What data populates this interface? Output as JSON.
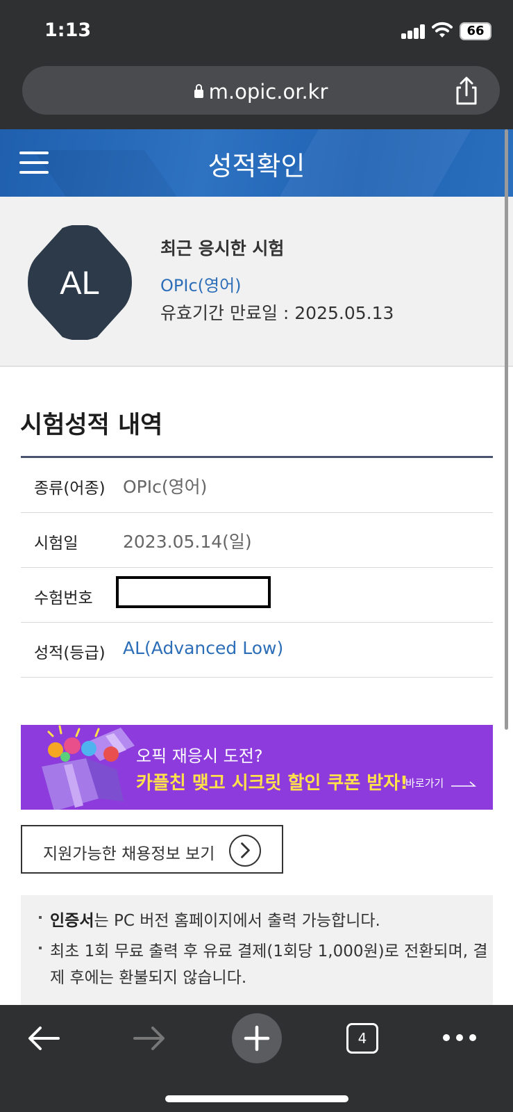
{
  "status_bar": {
    "time": "1:13",
    "battery": "66"
  },
  "browser": {
    "url": "m.opic.or.kr",
    "open_tabs": "4"
  },
  "header": {
    "title": "성적확인"
  },
  "recent_exam": {
    "avatar_grade": "AL",
    "heading": "최근 응시한 시험",
    "exam_name": "OPIc(영어)",
    "expiry": "유효기간 만료일 : 2025.05.13"
  },
  "score_history": {
    "title": "시험성적 내역",
    "rows": [
      {
        "label": "종류(어종)",
        "value": "OPIc(영어)"
      },
      {
        "label": "시험일",
        "value": "2023.05.14(일)"
      },
      {
        "label": "수험번호",
        "value": ""
      },
      {
        "label": "성적(등급)",
        "value": "AL(Advanced Low)"
      }
    ]
  },
  "promo": {
    "line1": "오픽 재응시 도전?",
    "line2": "카플친 맺고 시크릿 할인 쿠폰 받자!",
    "link": "바로가기",
    "bg_color": "#8d3bdc",
    "highlight_color": "#ffe14a"
  },
  "job_button": {
    "label": "지원가능한 채용정보 보기"
  },
  "notices": [
    {
      "bold": "인증서",
      "text": "는 PC 버전 홈페이지에서 출력 가능합니다."
    },
    {
      "bold": "",
      "text": "최초 1회 무료 출력 후 유료 결제(1회당 1,000원)로 전환되며, 결제 후에는 환불되지 않습니다."
    }
  ],
  "colors": {
    "accent_blue": "#2d6eb8",
    "header_blue": "#2e72c2",
    "avatar_dark": "#2c3a4a"
  }
}
